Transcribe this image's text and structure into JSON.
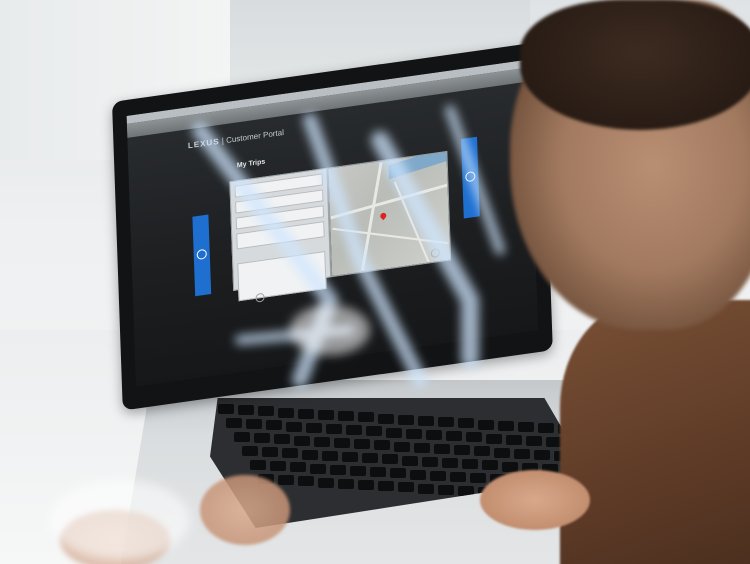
{
  "scene": {
    "description": "",
    "screen": {
      "brand": "LEXUS",
      "portal_title": "Customer Portal",
      "page_title": "My Trips",
      "card_rows": [
        "",
        "",
        "",
        "",
        ""
      ],
      "nav_items": [
        "",
        "",
        ""
      ]
    }
  },
  "colors": {
    "accent_blue": "#1e6fd0",
    "screen_bg": "#1c1e20",
    "map_pin": "#dd2222"
  }
}
